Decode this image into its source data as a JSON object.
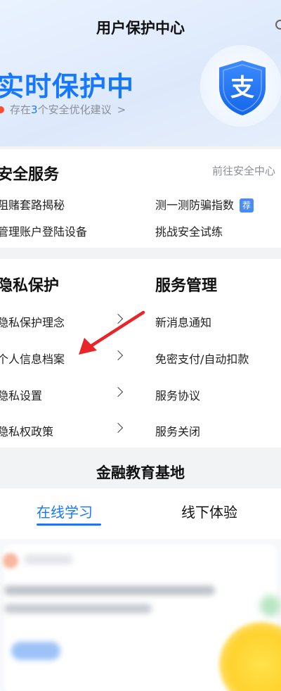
{
  "header": {
    "title": "用户保护中心"
  },
  "hero": {
    "title": "实时保护中",
    "subtitle_prefix": "存在",
    "subtitle_count": "3",
    "subtitle_suffix": "个安全优化建议",
    "shield_glyph": "支",
    "accent_color": "#1677ff"
  },
  "security_services": {
    "title": "安全服务",
    "link": "前往安全中心",
    "items": [
      {
        "label": "阻赌套路揭秘"
      },
      {
        "label": "测一测防骗指数",
        "badge": "荐"
      },
      {
        "label": "管理账户登陆设备"
      },
      {
        "label": "挑战安全试练"
      }
    ]
  },
  "privacy": {
    "title": "隐私保护",
    "items": [
      {
        "label": "隐私保护理念"
      },
      {
        "label": "个人信息档案"
      },
      {
        "label": "隐私设置"
      },
      {
        "label": "隐私权政策"
      }
    ]
  },
  "service_management": {
    "title": "服务管理",
    "items": [
      {
        "label": "新消息通知"
      },
      {
        "label": "免密支付/自动扣款"
      },
      {
        "label": "服务协议"
      },
      {
        "label": "服务关闭"
      }
    ]
  },
  "education": {
    "title": "金融教育基地",
    "tabs": [
      {
        "label": "在线学习",
        "active": true
      },
      {
        "label": "线下体验",
        "active": false
      }
    ]
  },
  "annotation": {
    "arrow_color": "#e8262a",
    "arrow_target": "个人信息档案"
  }
}
